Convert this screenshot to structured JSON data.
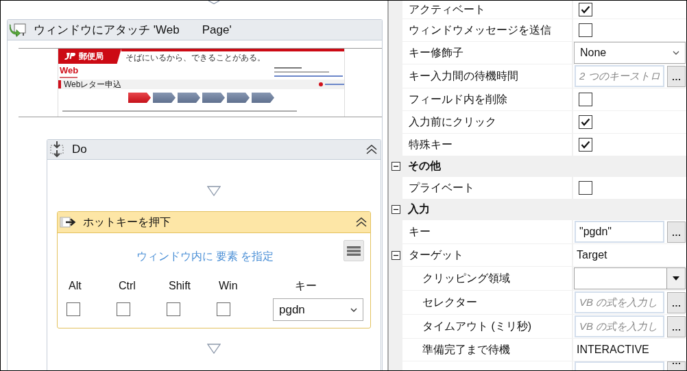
{
  "designer": {
    "attach": {
      "title": "ウィンドウにアタッチ 'Web       Page'",
      "preview": {
        "logo_text": "郵便局",
        "tagline": "そばにいるから、できることがある。",
        "brand": "Web",
        "heading": "Webレター申込",
        "steps": [
          {
            "selected": true
          },
          {
            "selected": false
          },
          {
            "selected": false
          },
          {
            "selected": false
          },
          {
            "selected": false
          },
          {
            "selected": false
          }
        ]
      }
    },
    "do": {
      "title": "Do"
    },
    "hotkey": {
      "title": "ホットキーを押下",
      "target_link": "ウィンドウ内に 要素 を指定",
      "modifiers": [
        {
          "label": "Alt",
          "checked": false
        },
        {
          "label": "Ctrl",
          "checked": false
        },
        {
          "label": "Shift",
          "checked": false
        },
        {
          "label": "Win",
          "checked": false
        }
      ],
      "key_label": "キー",
      "key_value": "pgdn"
    }
  },
  "properties": {
    "items": [
      {
        "kind": "checkbox",
        "name": "アクティベート",
        "checked": true
      },
      {
        "kind": "checkbox",
        "name": "ウィンドウメッセージを送信",
        "checked": false
      },
      {
        "kind": "dropdown",
        "name": "キー修飾子",
        "value": "None"
      },
      {
        "kind": "input",
        "name": "キー入力間の待機時間",
        "placeholder": "2 つのキーストロ"
      },
      {
        "kind": "checkbox",
        "name": "フィールド内を削除",
        "checked": false
      },
      {
        "kind": "checkbox",
        "name": "入力前にクリック",
        "checked": true
      },
      {
        "kind": "checkbox",
        "name": "特殊キー",
        "checked": true
      },
      {
        "kind": "category",
        "name": "その他",
        "expanded": true,
        "children": [
          {
            "kind": "checkbox",
            "name": "プライベート",
            "checked": false
          }
        ]
      },
      {
        "kind": "category",
        "name": "入力",
        "expanded": true,
        "children": [
          {
            "kind": "input",
            "name": "キー",
            "value": "\"pgdn\""
          },
          {
            "kind": "text",
            "name": "ターゲット",
            "value": "Target",
            "expanded": true,
            "children": [
              {
                "kind": "combo",
                "name": "クリッピング領域"
              },
              {
                "kind": "input",
                "name": "セレクター",
                "placeholder": "VB の式を入力し"
              },
              {
                "kind": "input",
                "name": "タイムアウト (ミリ秒)",
                "placeholder": "VB の式を入力し"
              },
              {
                "kind": "text",
                "name": "準備完了まで待機",
                "value": "INTERACTIVE"
              },
              {
                "kind": "input"
              }
            ]
          }
        ]
      }
    ]
  }
}
